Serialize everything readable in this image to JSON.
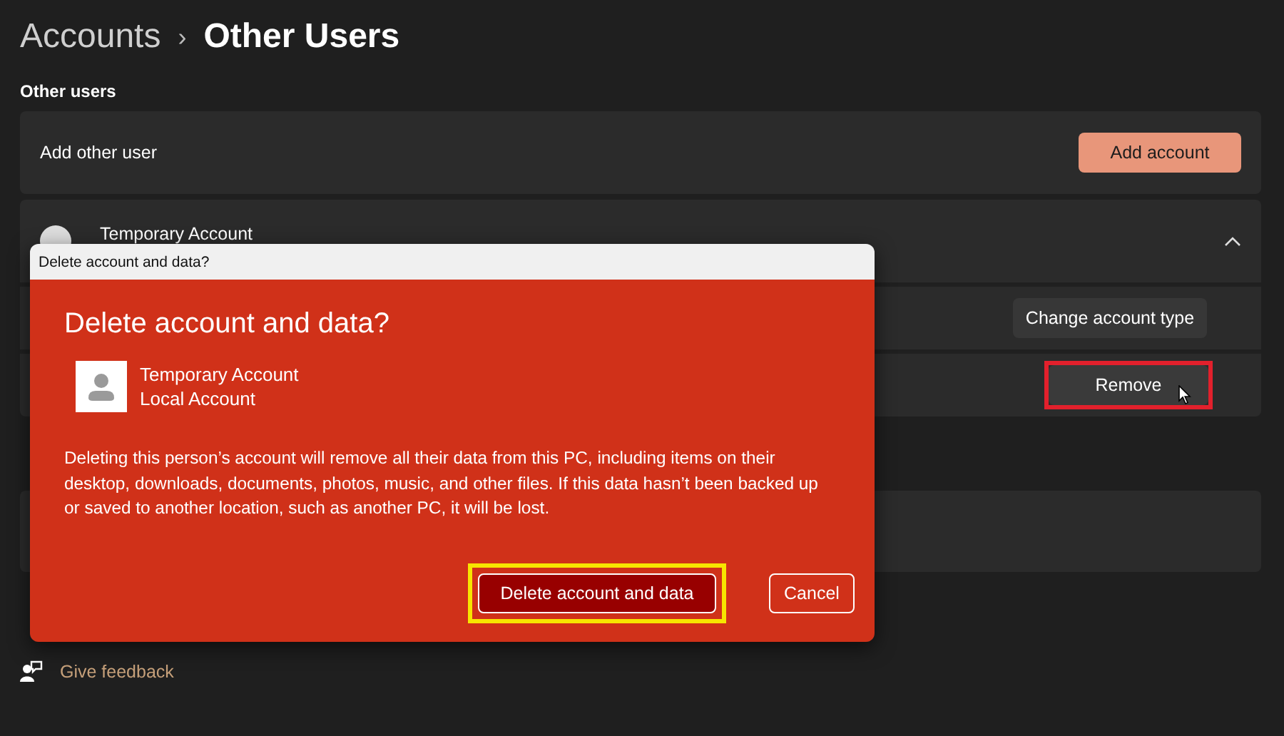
{
  "breadcrumb": {
    "parent": "Accounts",
    "separator": "›",
    "current": "Other Users"
  },
  "section_title": "Other users",
  "add_user": {
    "label": "Add other user",
    "button": "Add account"
  },
  "account": {
    "name": "Temporary Account",
    "expanded": true,
    "actions": [
      {
        "label": "Change account type"
      },
      {
        "label": "Remove",
        "color": "#e2202c"
      }
    ]
  },
  "feedback": {
    "label": "Give feedback"
  },
  "dialog": {
    "title": "Delete account and data?",
    "heading": "Delete account and data?",
    "account_name": "Temporary Account",
    "account_type": "Local Account",
    "message": "Deleting this person’s account will remove all their data from this PC, including items on their desktop, downloads, documents, photos, music, and other files. If this data hasn’t been backed up or saved to another location, such as another PC, it will be lost.",
    "buttons": [
      {
        "label": "Delete account and data",
        "kind": "primary",
        "color": "#f7e500"
      },
      {
        "label": "Cancel",
        "kind": "secondary"
      }
    ]
  }
}
